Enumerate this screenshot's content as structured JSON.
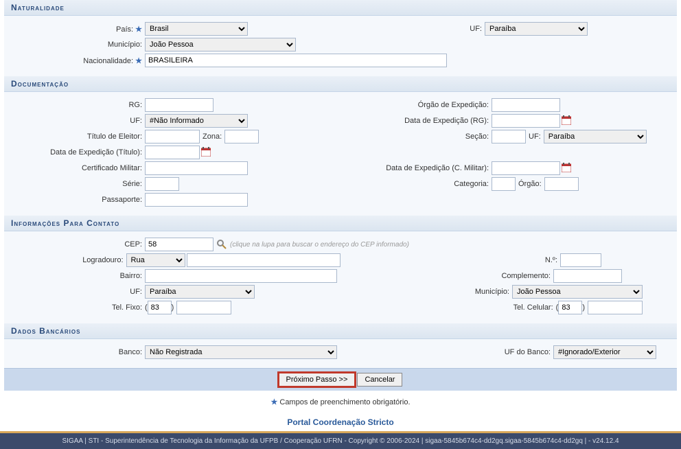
{
  "sections": {
    "naturalidade": {
      "title": "Naturalidade",
      "pais_label": "País:",
      "pais_value": "Brasil",
      "uf_label": "UF:",
      "uf_value": "Paraíba",
      "municipio_label": "Município:",
      "municipio_value": "João Pessoa",
      "nacionalidade_label": "Nacionalidade:",
      "nacionalidade_value": "BRASILEIRA"
    },
    "documentacao": {
      "title": "Documentação",
      "rg_label": "RG:",
      "orgao_exp_label": "Órgão de Expedição:",
      "uf_label": "UF:",
      "uf_value": "#Não Informado",
      "data_exp_rg_label": "Data de Expedição (RG):",
      "titulo_label": "Título de Eleitor:",
      "zona_label": "Zona:",
      "secao_label": "Seção:",
      "uf2_label": "UF:",
      "uf2_value": "Paraíba",
      "data_exp_titulo_label": "Data de Expedição (Título):",
      "cert_militar_label": "Certificado Militar:",
      "data_exp_militar_label": "Data de Expedição (C. Militar):",
      "serie_label": "Série:",
      "categoria_label": "Categoria:",
      "orgao_label": "Órgão:",
      "passaporte_label": "Passaporte:"
    },
    "contato": {
      "title": "Informações Para Contato",
      "cep_label": "CEP:",
      "cep_value": "58",
      "cep_hint": "(clique na lupa para buscar o endereço do CEP informado)",
      "logradouro_label": "Logradouro:",
      "logradouro_tipo": "Rua",
      "numero_label": "N.º:",
      "bairro_label": "Bairro:",
      "complemento_label": "Complemento:",
      "uf_label": "UF:",
      "uf_value": "Paraíba",
      "municipio_label": "Município:",
      "municipio_value": "João Pessoa",
      "tel_fixo_label": "Tel. Fixo:",
      "tel_fixo_ddd": "83",
      "tel_cel_label": "Tel. Celular:",
      "tel_cel_ddd": "83"
    },
    "bancarios": {
      "title": "Dados Bancários",
      "banco_label": "Banco:",
      "banco_value": "Não Registrada",
      "uf_banco_label": "UF do Banco:",
      "uf_banco_value": "#Ignorado/Exterior"
    }
  },
  "buttons": {
    "proximo": "Próximo Passo >>",
    "cancelar": "Cancelar"
  },
  "required_note": "Campos de preenchimento obrigatório.",
  "portal_link": "Portal Coordenação Stricto",
  "footer": "SIGAA | STI - Superintendência de Tecnologia da Informação da UFPB / Cooperação UFRN - Copyright © 2006-2024 | sigaa-5845b674c4-dd2gq.sigaa-5845b674c4-dd2gq | - v24.12.4"
}
